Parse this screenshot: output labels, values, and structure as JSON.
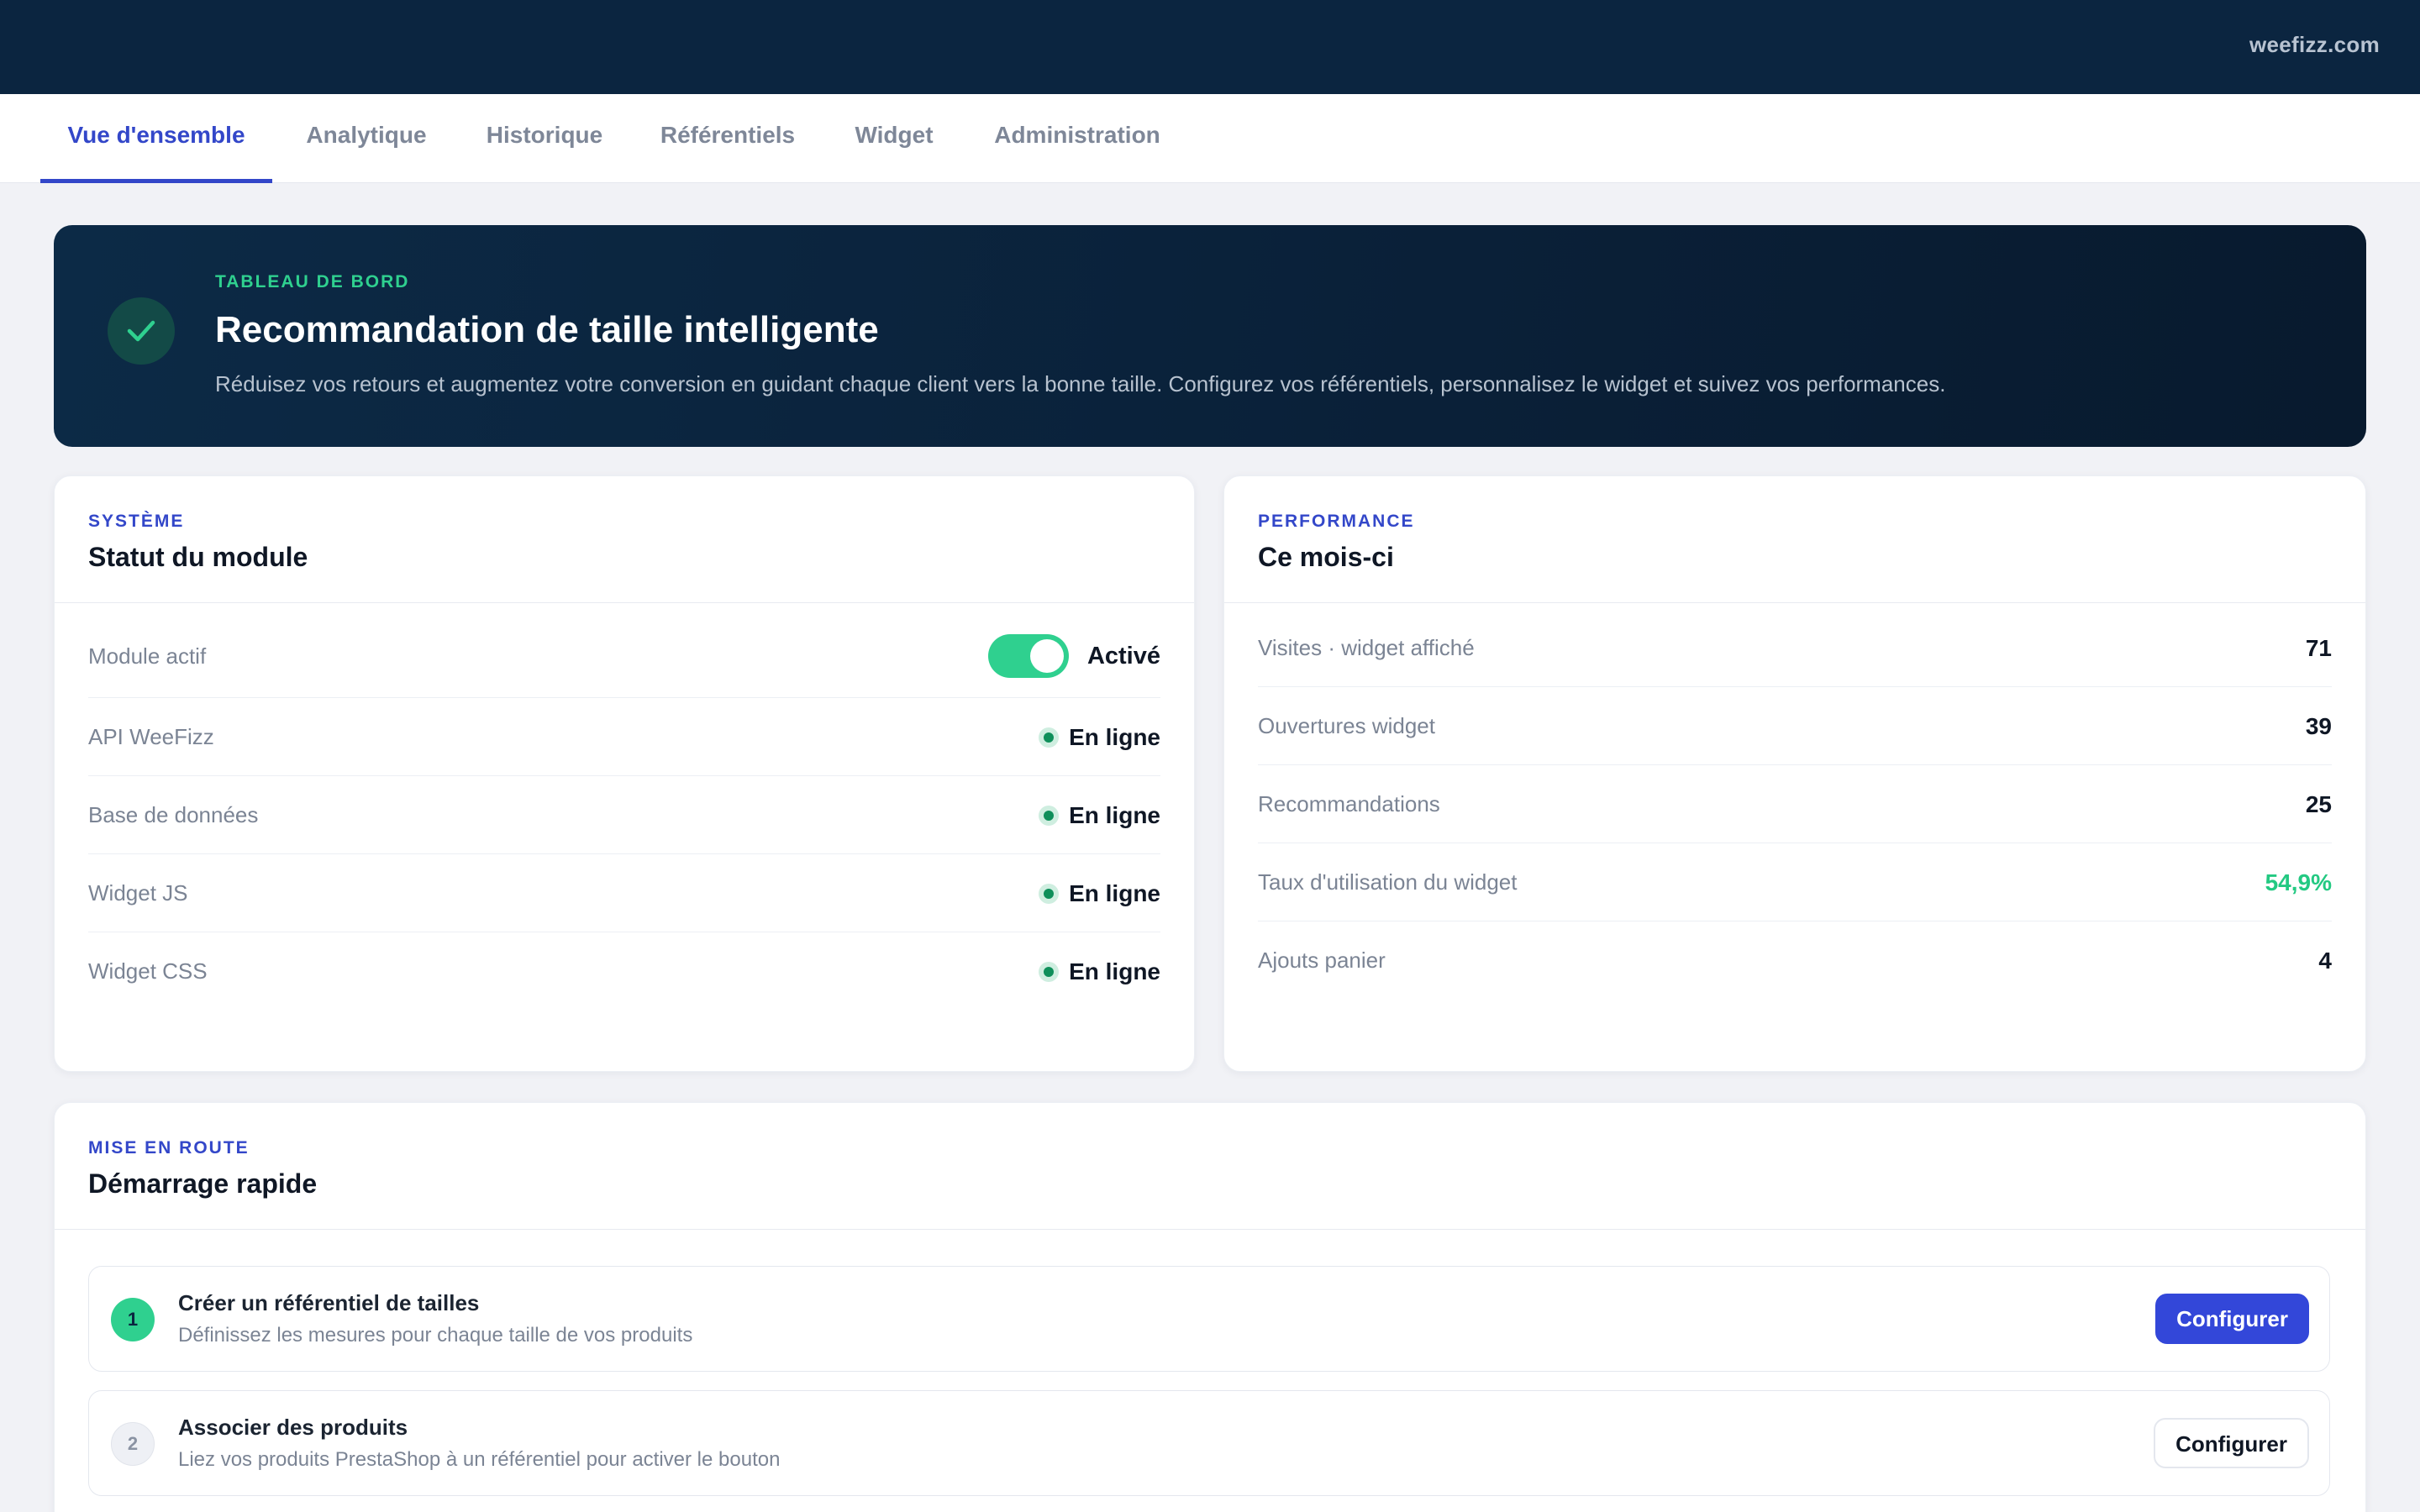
{
  "header": {
    "site": "weefizz.com"
  },
  "tabs": [
    {
      "label": "Vue d'ensemble",
      "active": true
    },
    {
      "label": "Analytique",
      "active": false
    },
    {
      "label": "Historique",
      "active": false
    },
    {
      "label": "Référentiels",
      "active": false
    },
    {
      "label": "Widget",
      "active": false
    },
    {
      "label": "Administration",
      "active": false
    }
  ],
  "hero": {
    "eyebrow": "TABLEAU DE BORD",
    "title": "Recommandation de taille intelligente",
    "description": "Réduisez vos retours et augmentez votre conversion en guidant chaque client vers la bonne taille. Configurez vos référentiels, personnalisez le widget et suivez vos performances.",
    "icon": "check-icon"
  },
  "system": {
    "eyebrow": "SYSTÈME",
    "title": "Statut du module",
    "module": {
      "label": "Module actif",
      "state": "Activé",
      "enabled": true
    },
    "services": [
      {
        "label": "API WeeFizz",
        "status": "En ligne"
      },
      {
        "label": "Base de données",
        "status": "En ligne"
      },
      {
        "label": "Widget JS",
        "status": "En ligne"
      },
      {
        "label": "Widget CSS",
        "status": "En ligne"
      }
    ],
    "status_color": "#0f8f5a"
  },
  "performance": {
    "eyebrow": "PERFORMANCE",
    "title": "Ce mois-ci",
    "metrics": [
      {
        "label": "Visites · widget affiché",
        "value": "71"
      },
      {
        "label": "Ouvertures widget",
        "value": "39"
      },
      {
        "label": "Recommandations",
        "value": "25"
      },
      {
        "label": "Taux d'utilisation du widget",
        "value": "54,9%"
      },
      {
        "label": "Ajouts panier",
        "value": "4"
      }
    ],
    "highlight_color": "#23c982"
  },
  "quickstart": {
    "eyebrow": "MISE EN ROUTE",
    "title": "Démarrage rapide",
    "steps": [
      {
        "number": "1",
        "title": "Créer un référentiel de tailles",
        "description": "Définissez les mesures pour chaque taille de vos produits",
        "button": "Configurer",
        "done": true
      },
      {
        "number": "2",
        "title": "Associer des produits",
        "description": "Liez vos produits PrestaShop à un référentiel pour activer le bouton",
        "button": "Configurer",
        "done": false
      }
    ]
  },
  "colors": {
    "accent": "#3347c9",
    "navy": "#0b2540",
    "success": "#2fd08f"
  }
}
